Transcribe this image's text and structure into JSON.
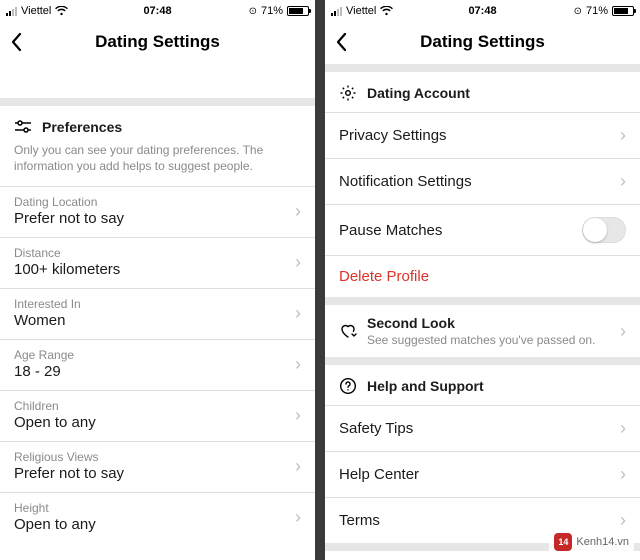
{
  "status": {
    "carrier": "Viettel",
    "time": "07:48",
    "battery_pct": "71%"
  },
  "left": {
    "title": "Dating Settings",
    "prefs_header": "Preferences",
    "prefs_sub": "Only you can see your dating preferences. The information you add helps to suggest people.",
    "rows": [
      {
        "label": "Dating Location",
        "value": "Prefer not to say"
      },
      {
        "label": "Distance",
        "value": "100+ kilometers"
      },
      {
        "label": "Interested In",
        "value": "Women"
      },
      {
        "label": "Age Range",
        "value": "18 - 29"
      },
      {
        "label": "Children",
        "value": "Open to any"
      },
      {
        "label": "Religious Views",
        "value": "Prefer not to say"
      },
      {
        "label": "Height",
        "value": "Open to any"
      }
    ]
  },
  "right": {
    "title": "Dating Settings",
    "account_header": "Dating Account",
    "account_rows": {
      "privacy": "Privacy Settings",
      "notifications": "Notification Settings",
      "pause": "Pause Matches",
      "delete": "Delete Profile"
    },
    "second_look": {
      "header": "Second Look",
      "sub": "See suggested matches you've passed on."
    },
    "support_header": "Help and Support",
    "support_rows": {
      "safety": "Safety Tips",
      "help": "Help Center",
      "terms": "Terms"
    }
  },
  "watermark": {
    "badge": "14",
    "text": "Kenh14.vn"
  }
}
